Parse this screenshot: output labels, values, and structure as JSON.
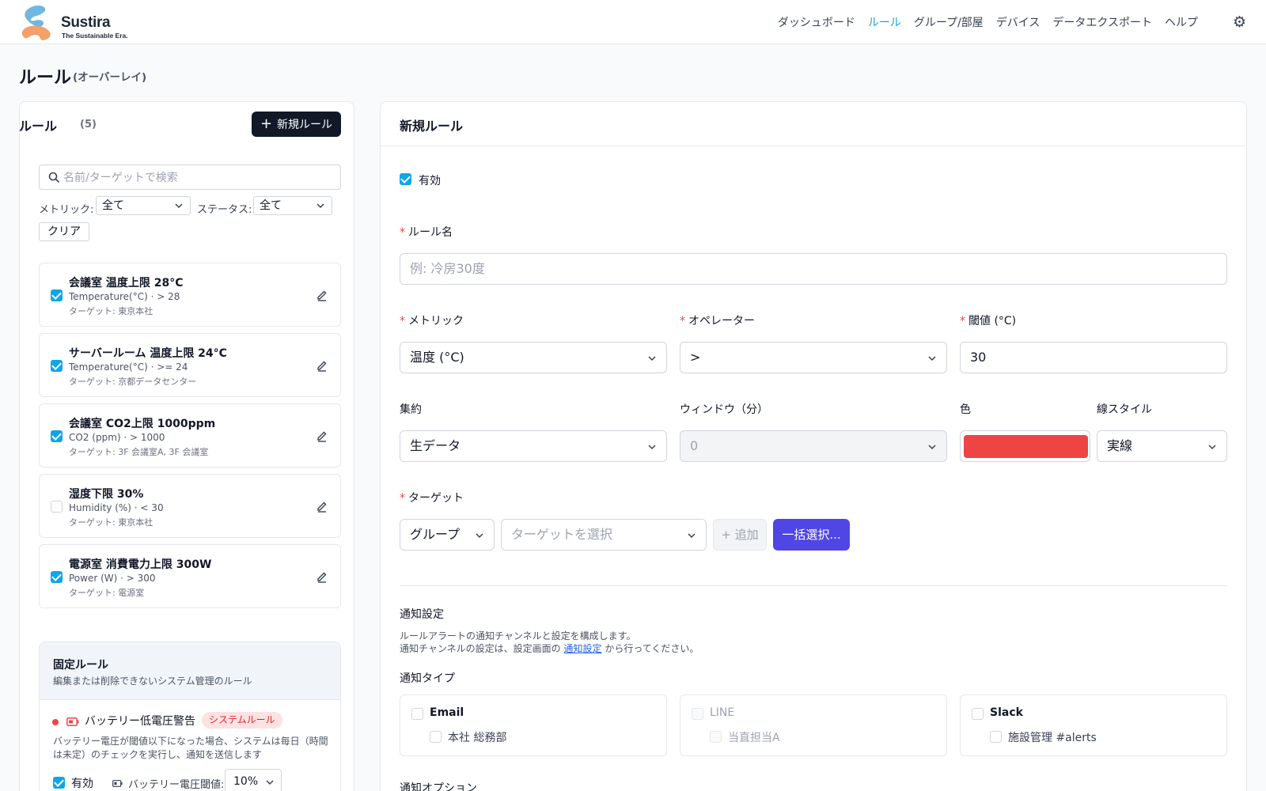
{
  "app": {
    "brand": "Sustira",
    "tagline": "The Sustainable Era."
  },
  "nav": {
    "items": [
      "ダッシュボード",
      "ルール",
      "グループ/部屋",
      "デバイス",
      "データエクスポート",
      "ヘルプ"
    ],
    "active_index": 1
  },
  "page": {
    "title": "ルール",
    "subtitle": "(オーバーレイ)"
  },
  "rules_panel": {
    "title": "ルール",
    "count": "(5)",
    "new_button": "新規ルール",
    "search_placeholder": "名前/ターゲットで検索",
    "metric_label": "メトリック:",
    "metric_value": "全て",
    "status_label": "ステータス:",
    "status_value": "全て",
    "clear_button": "クリア",
    "rules": [
      {
        "name": "会議室 温度上限 28°C",
        "meta": "Temperature(°C) · > 28",
        "target": "ターゲット: 東京本社",
        "enabled": true
      },
      {
        "name": "サーバールーム 温度上限 24°C",
        "meta": "Temperature(°C) · >= 24",
        "target": "ターゲット: 京都データセンター",
        "enabled": true
      },
      {
        "name": "会議室 CO2上限 1000ppm",
        "meta": "CO2 (ppm) · > 1000",
        "target": "ターゲット: 3F 会議室A, 3F 会議室",
        "enabled": true
      },
      {
        "name": "湿度下限 30%",
        "meta": "Humidity (%) · < 30",
        "target": "ターゲット: 東京本社",
        "enabled": false
      },
      {
        "name": "電源室 消費電力上限 300W",
        "meta": "Power (W) · > 300",
        "target": "ターゲット: 電源室",
        "enabled": true
      }
    ],
    "fixed": {
      "title": "固定ルール",
      "description": "編集または削除できないシステム管理のルール",
      "rule_name": "バッテリー低電圧警告",
      "badge": "システムルール",
      "text": "バッテリー電圧が閾値以下になった場合、システムは毎日（時間は未定）のチェックを実行し、通知を送信します",
      "enabled_label": "有効",
      "threshold_label": "バッテリー電圧閾値:",
      "threshold_value": "10%"
    }
  },
  "form": {
    "title": "新規ルール",
    "enabled_label": "有効",
    "name_label": "ルール名",
    "name_placeholder": "例: 冷房30度",
    "metric_label": "メトリック",
    "metric_value": "温度 (°C)",
    "operator_label": "オペレーター",
    "operator_value": ">",
    "threshold_label": "閾値 (°C)",
    "threshold_value": "30",
    "aggregation_label": "集約",
    "aggregation_value": "生データ",
    "window_label": "ウィンドウ（分）",
    "window_value": "0",
    "color_label": "色",
    "color_value": "#ef4444",
    "line_style_label": "線スタイル",
    "line_style_value": "実線",
    "target_label": "ターゲット",
    "target_type_value": "グループ",
    "target_placeholder": "ターゲットを選択",
    "add_button": "+ 追加",
    "bulk_button": "一括選択...",
    "notification": {
      "title": "通知設定",
      "desc_line1": "ルールアラートの通知チャンネルと設定を構成します。",
      "desc_line2_pre": "通知チャンネルの設定は、設定画面の",
      "desc_link": "通知設定",
      "desc_line2_post": "から行ってください。",
      "type_label": "通知タイプ",
      "channels": [
        {
          "name": "Email",
          "sub": "本社 総務部",
          "disabled": false
        },
        {
          "name": "LINE",
          "sub": "当直担当A",
          "disabled": true
        },
        {
          "name": "Slack",
          "sub": "施設管理 #alerts",
          "disabled": false
        }
      ],
      "options_label": "通知オプション"
    }
  }
}
